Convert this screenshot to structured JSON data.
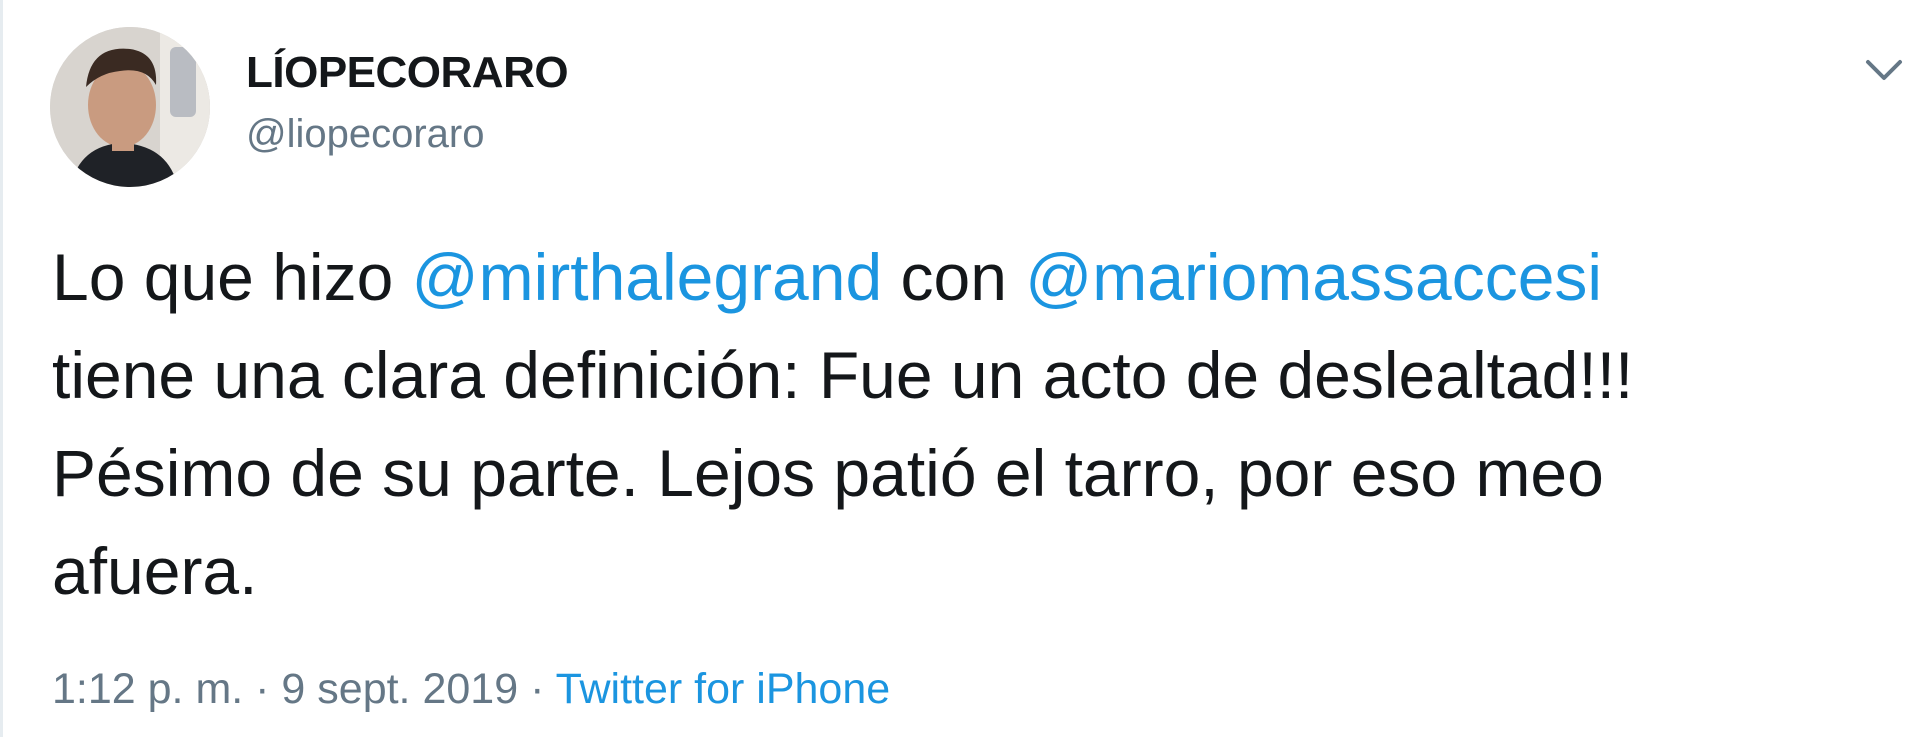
{
  "tweet": {
    "display_name": "LÍOPECORARO",
    "handle": "@liopecoraro",
    "text": {
      "line1_prefix": "Lo que hizo ",
      "mention1": "@mirthalegrand",
      "line1_mid": " con ",
      "mention2": "@mariomassaccesi",
      "line2": " tiene una clara definición: Fue un acto de deslealtad!!!",
      "line3": "Pésimo de su parte. Lejos patió el tarro, por eso meo",
      "line4": "afuera."
    },
    "timestamp": "1:12 p. m. · 9 sept. 2019",
    "separator": " · ",
    "source": "Twitter for iPhone"
  },
  "icons": {
    "menu": "chevron-down-icon",
    "avatar": "profile-photo"
  },
  "colors": {
    "link": "#1b95e0",
    "text": "#14171a",
    "muted": "#657786"
  }
}
